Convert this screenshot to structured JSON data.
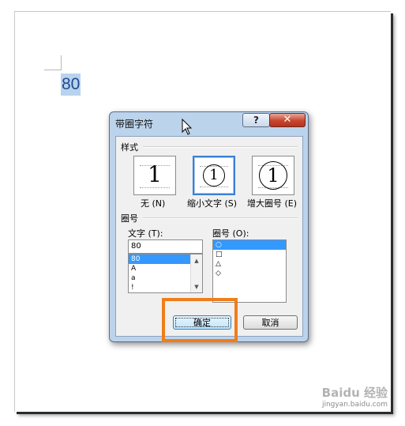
{
  "document": {
    "text": "80"
  },
  "dialog": {
    "title": "带圈字符",
    "help_glyph": "?",
    "close_glyph": "✕",
    "style_group_label": "样式",
    "style_options": [
      {
        "label": "无 (N)",
        "glyph": "1"
      },
      {
        "label": "缩小文字 (S)",
        "glyph": "1"
      },
      {
        "label": "增大圈号 (E)",
        "glyph": "1"
      }
    ],
    "selected_style": "缩小文字 (S)",
    "ring_group_label": "圈号",
    "text_label": "文字 (T):",
    "text_value": "80",
    "text_list": [
      "80",
      "A",
      "a",
      "!"
    ],
    "ring_label": "圈号 (O):",
    "ring_list": [
      "○",
      "□",
      "△",
      "◇"
    ],
    "ok_label": "确定",
    "cancel_label": "取消"
  },
  "watermark": {
    "line1": "Baidu 经验",
    "line2": "jingyan.baidu.com"
  }
}
